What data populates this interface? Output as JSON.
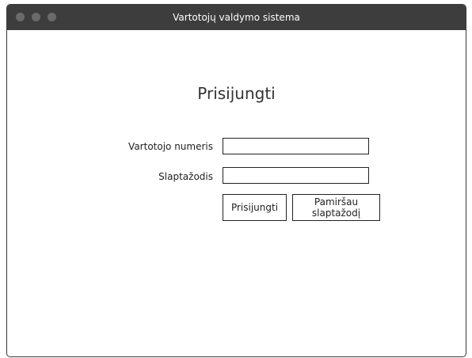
{
  "window": {
    "title": "Vartotojų valdymo sistema",
    "controls": [
      "close-dot",
      "minimize-dot",
      "maximize-dot"
    ]
  },
  "login": {
    "heading": "Prisijungti",
    "user_number_label": "Vartotojo numeris",
    "user_number_value": "",
    "password_label": "Slaptažodis",
    "password_value": "",
    "login_button": "Prisijungti",
    "forgot_button": "Pamiršau slaptažodį"
  }
}
